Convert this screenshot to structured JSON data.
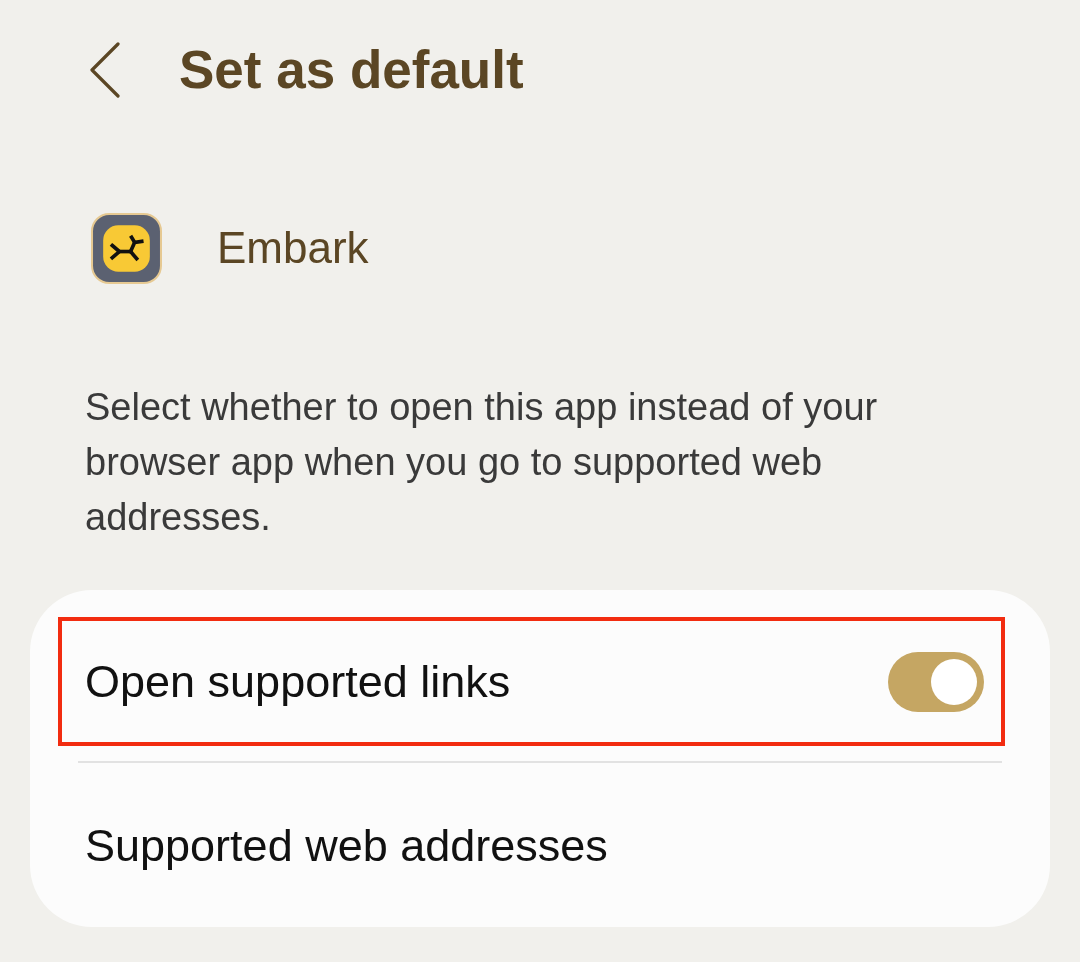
{
  "header": {
    "title": "Set as default"
  },
  "app": {
    "name": "Embark"
  },
  "description": "Select whether to open this app instead of your browser app when you go to supported web addresses.",
  "settings": [
    {
      "kind": "toggle",
      "label": "Open supported links",
      "on": true,
      "highlighted": true
    },
    {
      "kind": "link",
      "label": "Supported web addresses",
      "highlighted": false
    }
  ]
}
